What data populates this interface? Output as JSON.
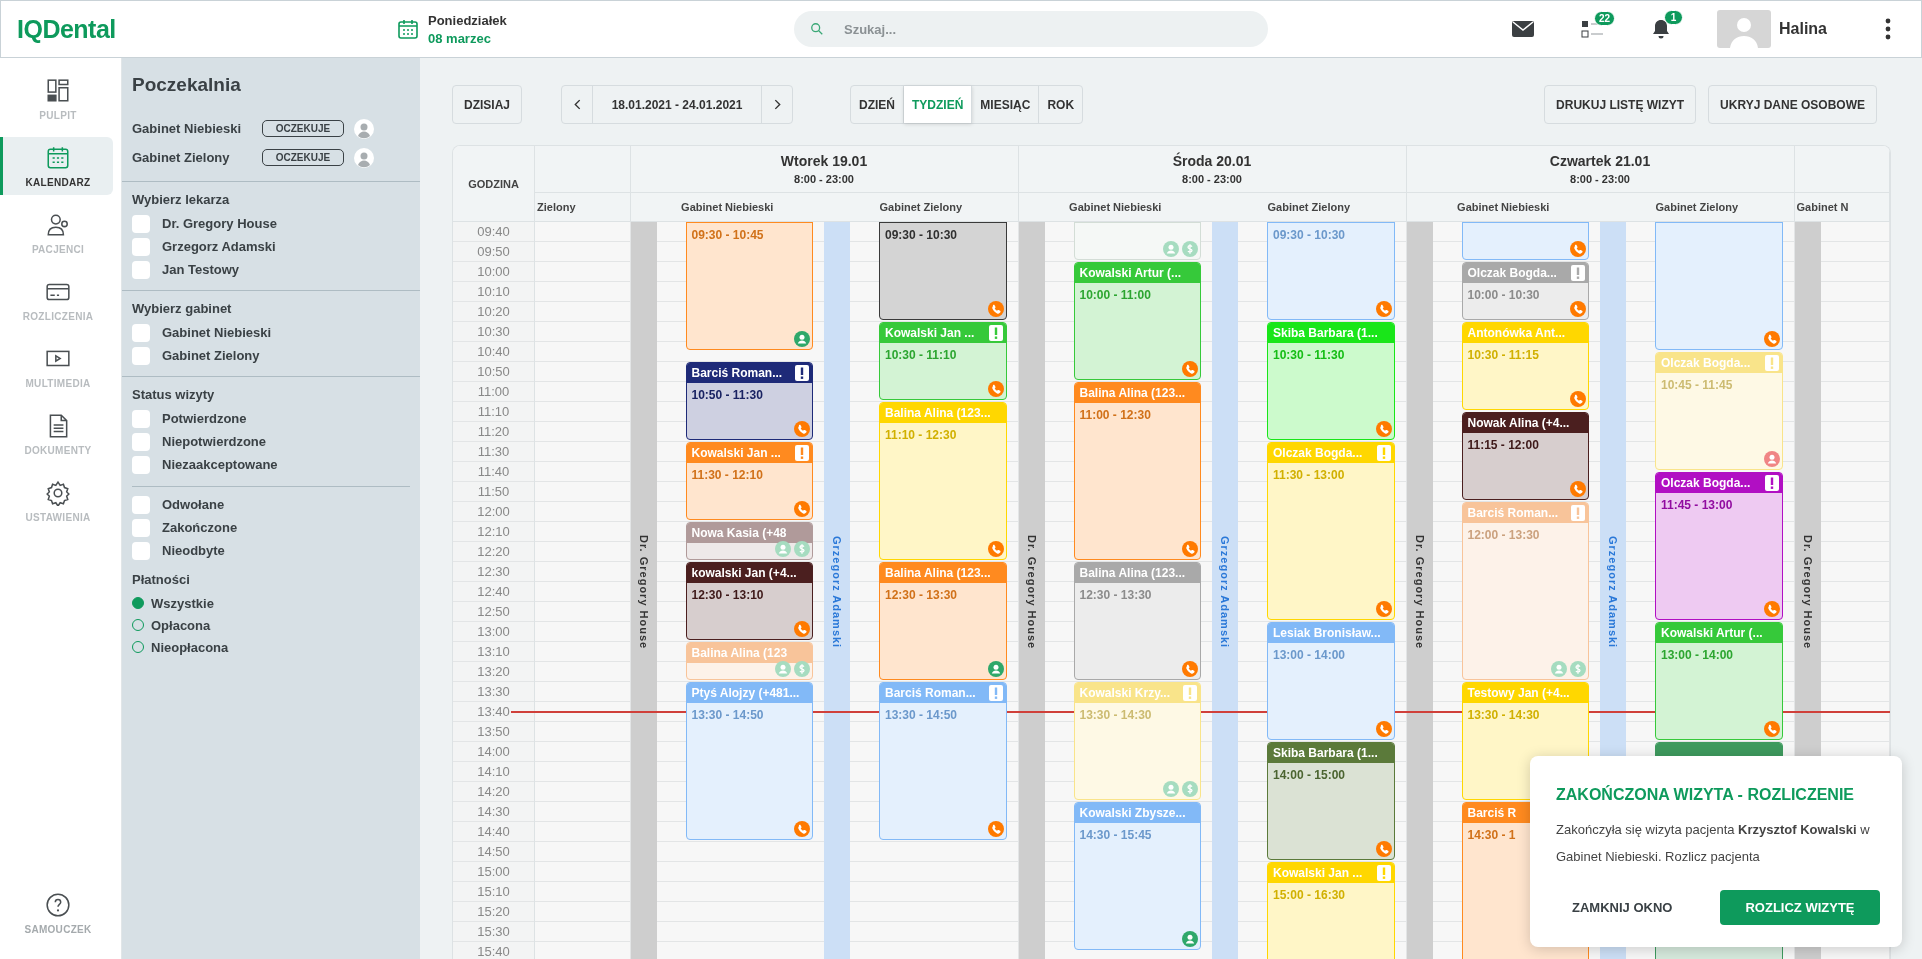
{
  "header": {
    "logo": "IQDental",
    "weekday": "Poniedziałek",
    "date": "08 marzec",
    "search": {
      "placeholder": "Szukaj..."
    },
    "tasks_count": "22",
    "alerts_count": "1",
    "user": "Halina"
  },
  "nav": {
    "items": [
      {
        "kind": "dashboard",
        "label": "PULPIT",
        "selected": false
      },
      {
        "kind": "calendar",
        "label": "KALENDARZ",
        "selected": true
      },
      {
        "kind": "patients",
        "label": "PACJENCI",
        "selected": false
      },
      {
        "kind": "billing",
        "label": "ROZLICZENIA",
        "selected": false
      },
      {
        "kind": "media",
        "label": "MULTIMEDIA",
        "selected": false
      },
      {
        "kind": "document",
        "label": "DOKUMENTY",
        "selected": false
      },
      {
        "kind": "settings",
        "label": "USTAWIENIA",
        "selected": false
      }
    ],
    "help": {
      "label": "SAMOUCZEK"
    }
  },
  "waiting_room": {
    "title": "Poczekalnia",
    "rooms": [
      {
        "name": "Gabinet Niebieski",
        "status": "OCZEKUJE"
      },
      {
        "name": "Gabinet Zielony",
        "status": "OCZEKUJE"
      }
    ]
  },
  "filter_groups": [
    {
      "title": "Wybierz lekarza",
      "options": [
        {
          "label": "Dr. Gregory House",
          "checked": false
        },
        {
          "label": "Grzegorz Adamski",
          "checked": false
        },
        {
          "label": "Jan Testowy",
          "checked": false
        }
      ]
    },
    {
      "title": "Wybierz gabinet",
      "options": [
        {
          "label": "Gabinet Niebieski",
          "checked": false
        },
        {
          "label": "Gabinet Zielony",
          "checked": false
        }
      ]
    },
    {
      "title": "Status wizyty",
      "options": [
        {
          "label": "Potwierdzone",
          "checked": false
        },
        {
          "label": "Niepotwierdzone",
          "checked": false
        },
        {
          "label": "Niezaakceptowane",
          "checked": false
        }
      ]
    },
    {
      "options": [
        {
          "label": "Odwołane",
          "checked": false
        },
        {
          "label": "Zakończone",
          "checked": false
        },
        {
          "label": "Nieodbyte",
          "checked": false
        }
      ]
    }
  ],
  "payments": {
    "title": "Płatności",
    "options": [
      {
        "label": "Wszystkie",
        "selected": true
      },
      {
        "label": "Opłacona",
        "selected": false
      },
      {
        "label": "Nieopłacona",
        "selected": false
      }
    ]
  },
  "toolbar": {
    "today": "DZISIAJ",
    "range": "18.01.2021 - 24.01.2021",
    "views": [
      {
        "label": "DZIEŃ",
        "selected": false
      },
      {
        "label": "TYDZIEŃ",
        "selected": true
      },
      {
        "label": "MIESIĄC",
        "selected": false
      },
      {
        "label": "ROK",
        "selected": false
      }
    ],
    "actions": [
      "DRUKUJ LISTĘ WIZYT",
      "UKRYJ DANE OSOBOWE"
    ]
  },
  "calendar": {
    "time_header": "GODZINA",
    "times": [
      {
        "label": "09:40",
        "current": false
      },
      {
        "label": "09:50",
        "current": false
      },
      {
        "label": "10:00",
        "current": false
      },
      {
        "label": "10:10",
        "current": false
      },
      {
        "label": "10:20",
        "current": false
      },
      {
        "label": "10:30",
        "current": false
      },
      {
        "label": "10:40",
        "current": false
      },
      {
        "label": "10:50",
        "current": false
      },
      {
        "label": "11:00",
        "current": false
      },
      {
        "label": "11:10",
        "current": false
      },
      {
        "label": "11:20",
        "current": false
      },
      {
        "label": "11:30",
        "current": false
      },
      {
        "label": "11:40",
        "current": false
      },
      {
        "label": "11:50",
        "current": false
      },
      {
        "label": "12:00",
        "current": false
      },
      {
        "label": "12:10",
        "current": false
      },
      {
        "label": "12:20",
        "current": false
      },
      {
        "label": "12:30",
        "current": false
      },
      {
        "label": "12:40",
        "current": false
      },
      {
        "label": "12:50",
        "current": false
      },
      {
        "label": "13:00",
        "current": false
      },
      {
        "label": "13:10",
        "current": false
      },
      {
        "label": "13:20",
        "current": false
      },
      {
        "label": "13:30",
        "current": false
      },
      {
        "label": "13:40",
        "current": true
      },
      {
        "label": "13:50",
        "current": false
      },
      {
        "label": "14:00",
        "current": false
      },
      {
        "label": "14:10",
        "current": false
      },
      {
        "label": "14:20",
        "current": false
      },
      {
        "label": "14:30",
        "current": false
      },
      {
        "label": "14:40",
        "current": false
      },
      {
        "label": "14:50",
        "current": false
      },
      {
        "label": "15:00",
        "current": false
      },
      {
        "label": "15:10",
        "current": false
      },
      {
        "label": "15:20",
        "current": false
      },
      {
        "label": "15:30",
        "current": false
      },
      {
        "label": "15:40",
        "current": false
      }
    ],
    "columns": [
      {
        "kind": "partial",
        "rooms": [
          {
            "name": "Zielony"
          }
        ]
      },
      {
        "kind": "day",
        "title": "Wtorek 19.01",
        "hours": "8:00 - 23:00",
        "rooms": [
          {
            "name": "Gabinet Niebieski",
            "doctor": {
              "name": "Dr. Gregory House",
              "color": "#333333"
            },
            "appointments": [
              {
                "time": "09:30 - 10:45",
                "color": "#ff8a1f",
                "alert": false,
                "badges": [
                  {
                    "kind": "patient",
                    "color": "#2fa86a"
                  }
                ]
              },
              {
                "name": "Barciś Roman...",
                "time": "10:50 - 11:30",
                "color": "#1e2a78",
                "alert": true,
                "badges": [
                  {
                    "kind": "phone",
                    "color": "#ff7a00"
                  }
                ]
              },
              {
                "name": "Kowalski Jan ...",
                "time": "11:30 - 12:10",
                "color": "#ff8a1f",
                "alert": true,
                "badges": [
                  {
                    "kind": "phone",
                    "color": "#ff7a00"
                  }
                ]
              },
              {
                "name": "Nowa Kasia (+48",
                "color": "#b09a9a",
                "alert": false,
                "badges": [
                  {
                    "kind": "patient",
                    "color": "#a6dcc0"
                  },
                  {
                    "kind": "payment",
                    "color": "#a6dcc0"
                  }
                ]
              },
              {
                "name": "kowalski Jan (+4...",
                "time": "12:30 - 13:10",
                "color": "#4b1f1f",
                "alert": false,
                "badges": [
                  {
                    "kind": "phone",
                    "color": "#ff7a00"
                  }
                ]
              },
              {
                "name": "Balina Alina (123",
                "color": "#f8c49a",
                "alert": false,
                "badges": [
                  {
                    "kind": "patient",
                    "color": "#a6dcc0"
                  },
                  {
                    "kind": "payment",
                    "color": "#a6dcc0"
                  }
                ]
              },
              {
                "name": "Ptyś Alojzy (+481...",
                "time": "13:30 - 14:50",
                "color": "#82b9f7",
                "alert": false,
                "badges": [
                  {
                    "kind": "phone",
                    "color": "#ff7a00"
                  }
                ]
              }
            ]
          },
          {
            "name": "Gabinet Zielony",
            "doctor": {
              "name": "Grzegorz Adamski",
              "color": "#2a78d8"
            },
            "appointments": [
              {
                "time": "09:30 - 10:30",
                "color": "#3a3a3a",
                "alert": false,
                "badges": [
                  {
                    "kind": "phone",
                    "color": "#ff7a00"
                  }
                ]
              },
              {
                "name": "Kowalski Jan ...",
                "time": "10:30 - 11:10",
                "color": "#36c93a",
                "alert": true,
                "badges": [
                  {
                    "kind": "phone",
                    "color": "#ff7a00"
                  }
                ]
              },
              {
                "name": "Balina Alina (123...",
                "time": "11:10 - 12:30",
                "color": "#ffd700",
                "alert": false,
                "badges": [
                  {
                    "kind": "phone",
                    "color": "#ff7a00"
                  }
                ]
              },
              {
                "name": "Balina Alina (123...",
                "time": "12:30 - 13:30",
                "color": "#ff8a1f",
                "alert": false,
                "badges": [
                  {
                    "kind": "patient",
                    "color": "#2fa86a"
                  }
                ]
              },
              {
                "name": "Barciś Roman...",
                "time": "13:30 - 14:50",
                "color": "#82b9f7",
                "alert": true,
                "badges": [
                  {
                    "kind": "phone",
                    "color": "#ff7a00"
                  }
                ]
              }
            ]
          }
        ]
      },
      {
        "kind": "day",
        "title": "Środa 20.01",
        "hours": "8:00 - 23:00",
        "rooms": [
          {
            "name": "Gabinet Niebieski",
            "doctor": {
              "name": "Dr. Gregory House",
              "color": "#333333"
            },
            "appointments": [
              {
                "color": "#d3ddd6",
                "alert": false,
                "badges": [
                  {
                    "kind": "patient",
                    "color": "#a6dcc0"
                  },
                  {
                    "kind": "payment",
                    "color": "#a6dcc0"
                  }
                ]
              },
              {
                "name": "Kowalski Artur (...",
                "time": "10:00 - 11:00",
                "color": "#36c93a",
                "alert": false,
                "badges": [
                  {
                    "kind": "phone",
                    "color": "#ff7a00"
                  }
                ]
              },
              {
                "name": "Balina Alina (123...",
                "time": "11:00 - 12:30",
                "color": "#ff8a1f",
                "alert": false,
                "badges": [
                  {
                    "kind": "phone",
                    "color": "#ff7a00"
                  }
                ]
              },
              {
                "name": "Balina Alina (123...",
                "time": "12:30 - 13:30",
                "color": "#a9a9a9",
                "alert": false,
                "badges": [
                  {
                    "kind": "phone",
                    "color": "#ff7a00"
                  }
                ]
              },
              {
                "name": "Kowalski Krzy...",
                "time": "13:30 - 14:30",
                "color": "#f9e48a",
                "alert": true,
                "badges": [
                  {
                    "kind": "patient",
                    "color": "#a6dcc0"
                  },
                  {
                    "kind": "payment",
                    "color": "#a6dcc0"
                  }
                ]
              },
              {
                "name": "Kowalski Zbysze...",
                "time": "14:30 - 15:45",
                "color": "#82b9f7",
                "alert": false,
                "badges": [
                  {
                    "kind": "patient",
                    "color": "#2fa86a"
                  }
                ]
              }
            ]
          },
          {
            "name": "Gabinet Zielony",
            "doctor": {
              "name": "Grzegorz Adamski",
              "color": "#2a78d8"
            },
            "appointments": [
              {
                "time": "09:30 - 10:30",
                "color": "#82b9f7",
                "alert": false,
                "badges": [
                  {
                    "kind": "phone",
                    "color": "#ff7a00"
                  }
                ]
              },
              {
                "name": "Skiba Barbara (1...",
                "time": "10:30 - 11:30",
                "color": "#19e619",
                "alert": false,
                "badges": [
                  {
                    "kind": "phone",
                    "color": "#ff7a00"
                  }
                ]
              },
              {
                "name": "Olczak Bogda...",
                "time": "11:30 - 13:00",
                "color": "#ffd700",
                "alert": true,
                "badges": [
                  {
                    "kind": "phone",
                    "color": "#ff7a00"
                  }
                ]
              },
              {
                "name": "Lesiak Bronisław...",
                "time": "13:00 - 14:00",
                "color": "#82b9f7",
                "alert": false,
                "badges": [
                  {
                    "kind": "phone",
                    "color": "#ff7a00"
                  }
                ]
              },
              {
                "name": "Skiba Barbara (1...",
                "time": "14:00 - 15:00",
                "color": "#5b7a3a",
                "alert": false,
                "badges": [
                  {
                    "kind": "phone",
                    "color": "#ff7a00"
                  }
                ]
              },
              {
                "name": "Kowalski Jan ...",
                "time": "15:00 - 16:30",
                "color": "#ffd700",
                "alert": true
              }
            ]
          }
        ]
      },
      {
        "kind": "day",
        "title": "Czwartek 21.01",
        "hours": "8:00 - 23:00",
        "rooms": [
          {
            "name": "Gabinet Niebieski",
            "doctor": {
              "name": "Dr. Gregory House",
              "color": "#333333"
            },
            "appointments": [
              {
                "color": "#82b9f7",
                "alert": false,
                "badges": [
                  {
                    "kind": "phone",
                    "color": "#ff7a00"
                  }
                ]
              },
              {
                "name": "Olczak Bogda...",
                "time": "10:00 - 10:30",
                "color": "#a9a9a9",
                "alert": true,
                "badges": [
                  {
                    "kind": "phone",
                    "color": "#ff7a00"
                  }
                ]
              },
              {
                "name": "Antonówka Ant...",
                "time": "10:30 - 11:15",
                "color": "#ffd700",
                "alert": false,
                "badges": [
                  {
                    "kind": "phone",
                    "color": "#ff7a00"
                  }
                ]
              },
              {
                "name": "Nowak Alina (+4...",
                "time": "11:15 - 12:00",
                "color": "#4b1f1f",
                "alert": false,
                "badges": [
                  {
                    "kind": "phone",
                    "color": "#ff7a00"
                  }
                ]
              },
              {
                "name": "Barciś Roman...",
                "time": "12:00 - 13:30",
                "color": "#f8c49a",
                "alert": true,
                "badges": [
                  {
                    "kind": "patient",
                    "color": "#a6dcc0"
                  },
                  {
                    "kind": "payment",
                    "color": "#a6dcc0"
                  }
                ]
              },
              {
                "name": "Testowy Jan (+4...",
                "time": "13:30 - 14:30",
                "color": "#ffd700",
                "alert": false
              },
              {
                "name": "Barciś R",
                "time": "14:30 - 1",
                "color": "#ff8a1f",
                "alert": false
              }
            ]
          },
          {
            "name": "Gabinet Zielony",
            "doctor": {
              "name": "Grzegorz Adamski",
              "color": "#2a78d8"
            },
            "appointments": [
              {
                "color": "#82b9f7",
                "alert": false,
                "badges": [
                  {
                    "kind": "phone",
                    "color": "#ff7a00"
                  }
                ]
              },
              {
                "name": "Olczak Bogda...",
                "time": "10:45 - 11:45",
                "color": "#f9e48a",
                "alert": true,
                "badges": [
                  {
                    "kind": "patient",
                    "color": "#f08585"
                  }
                ]
              },
              {
                "name": "Olczak Bogda...",
                "time": "11:45 - 13:00",
                "color": "#b10fc3",
                "alert": true,
                "badges": [
                  {
                    "kind": "phone",
                    "color": "#ff7a00"
                  }
                ]
              },
              {
                "name": "Kowalski Artur (...",
                "time": "13:00 - 14:00",
                "color": "#36c93a",
                "alert": false,
                "badges": [
                  {
                    "kind": "phone",
                    "color": "#ff7a00"
                  }
                ]
              },
              {
                "color": "#3e9a5e",
                "alert": false
              }
            ]
          }
        ]
      },
      {
        "kind": "partial",
        "rooms": [
          {
            "name": "Gabinet N",
            "doctor": {
              "name": "Dr. Gregory House",
              "color": "#333333"
            }
          }
        ]
      }
    ]
  },
  "notification": {
    "title": "ZAKOŃCZONA WIZYTA - ROZLICZENIE",
    "message": "Zakończyła się wizyta pacjenta **Krzysztof Kowalski** w Gabinet Niebieski. Rozlicz pacjenta",
    "dismiss": "ZAMKNIJ OKNO",
    "confirm": "ROZLICZ WIZYTĘ"
  }
}
